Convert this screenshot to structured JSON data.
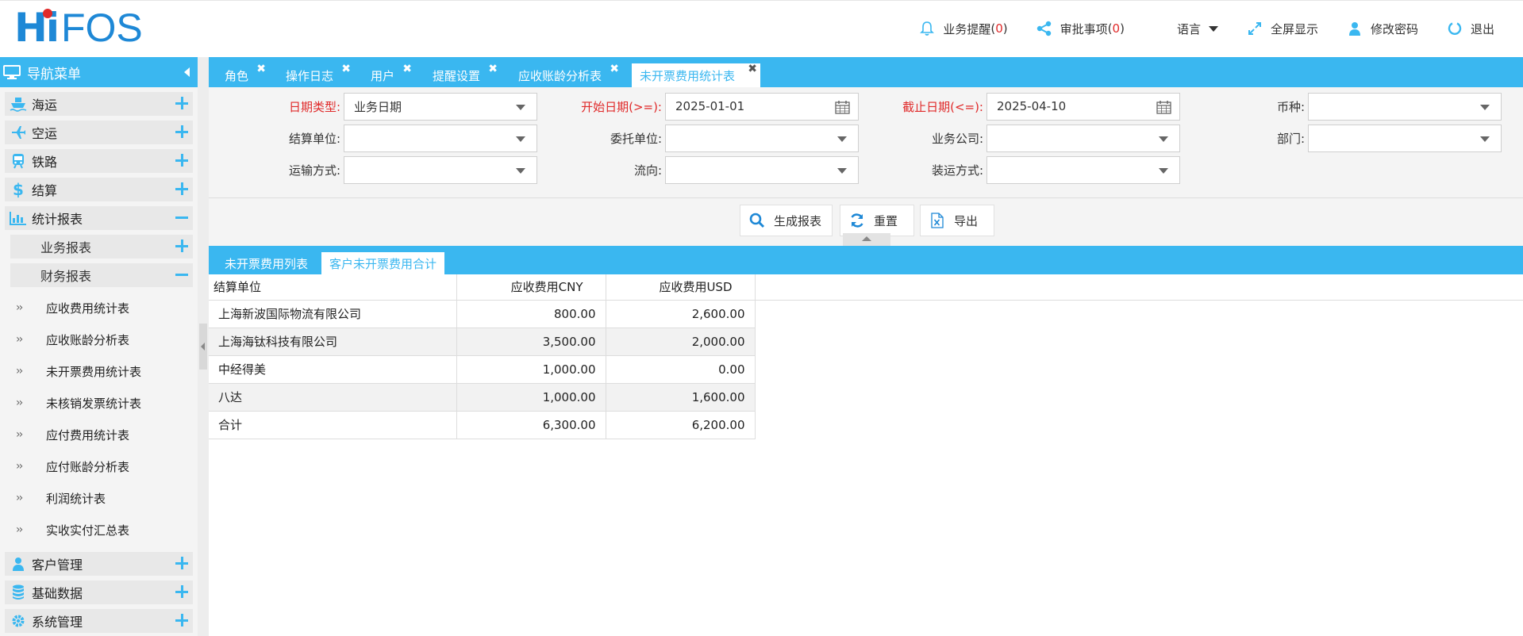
{
  "header": {
    "logo_hi": "Hi",
    "logo_fos": "FOS",
    "nav": [
      {
        "label": "业务提醒",
        "count": "0",
        "icon": "bell-icon"
      },
      {
        "label": "审批事项",
        "count": "0",
        "icon": "share-icon"
      },
      {
        "label": "语言",
        "icon": "caret-down-icon"
      },
      {
        "label": "全屏显示",
        "icon": "expand-icon"
      },
      {
        "label": "修改密码",
        "icon": "user-icon"
      },
      {
        "label": "退出",
        "icon": "power-icon"
      }
    ]
  },
  "sidebar": {
    "title": "导航菜单",
    "top_items": [
      {
        "label": "海运",
        "icon": "ship-icon"
      },
      {
        "label": "空运",
        "icon": "plane-icon"
      },
      {
        "label": "铁路",
        "icon": "train-icon"
      },
      {
        "label": "结算",
        "icon": "dollar-icon"
      },
      {
        "label": "统计报表",
        "icon": "bar-chart-icon"
      }
    ],
    "sub_items": [
      "业务报表",
      "财务报表"
    ],
    "leaves": [
      "应收费用统计表",
      "应收账龄分析表",
      "未开票费用统计表",
      "未核销发票统计表",
      "应付费用统计表",
      "应付账龄分析表",
      "利润统计表",
      "实收实付汇总表"
    ],
    "bottom_items": [
      {
        "label": "客户管理",
        "icon": "user-icon"
      },
      {
        "label": "基础数据",
        "icon": "database-icon"
      },
      {
        "label": "系统管理",
        "icon": "gear-icon"
      }
    ]
  },
  "tabs": [
    "角色",
    "操作日志",
    "用户",
    "提醒设置",
    "应收账龄分析表",
    "未开票费用统计表"
  ],
  "filters": {
    "date_type": {
      "label": "日期类型:",
      "value": "业务日期"
    },
    "start_date": {
      "label": "开始日期(>=):",
      "value": "2025-01-01"
    },
    "end_date": {
      "label": "截止日期(<=):",
      "value": "2025-04-10"
    },
    "currency": {
      "label": "币种:",
      "value": ""
    },
    "settle_unit": {
      "label": "结算单位:",
      "value": ""
    },
    "consignor": {
      "label": "委托单位:",
      "value": ""
    },
    "company": {
      "label": "业务公司:",
      "value": ""
    },
    "department": {
      "label": "部门:",
      "value": ""
    },
    "transport": {
      "label": "运输方式:",
      "value": ""
    },
    "flow": {
      "label": "流向:",
      "value": ""
    },
    "shipping": {
      "label": "装运方式:",
      "value": ""
    }
  },
  "actions": {
    "generate": "生成报表",
    "reset": "重置",
    "export": "导出"
  },
  "result_tabs": [
    "未开票费用列表",
    "客户未开票费用合计"
  ],
  "table": {
    "headers": [
      "结算单位",
      "应收费用CNY",
      "应收费用USD"
    ],
    "rows": [
      [
        "上海新波国际物流有限公司",
        "800.00",
        "2,600.00"
      ],
      [
        "上海海钛科技有限公司",
        "3,500.00",
        "2,000.00"
      ],
      [
        "中经得美",
        "1,000.00",
        "0.00"
      ],
      [
        "八达",
        "1,000.00",
        "1,600.00"
      ],
      [
        "合计",
        "6,300.00",
        "6,200.00"
      ]
    ]
  },
  "colors": {
    "accent": "#3ab7f0",
    "alert": "#e02a2a",
    "logo": "#1e88d6"
  }
}
